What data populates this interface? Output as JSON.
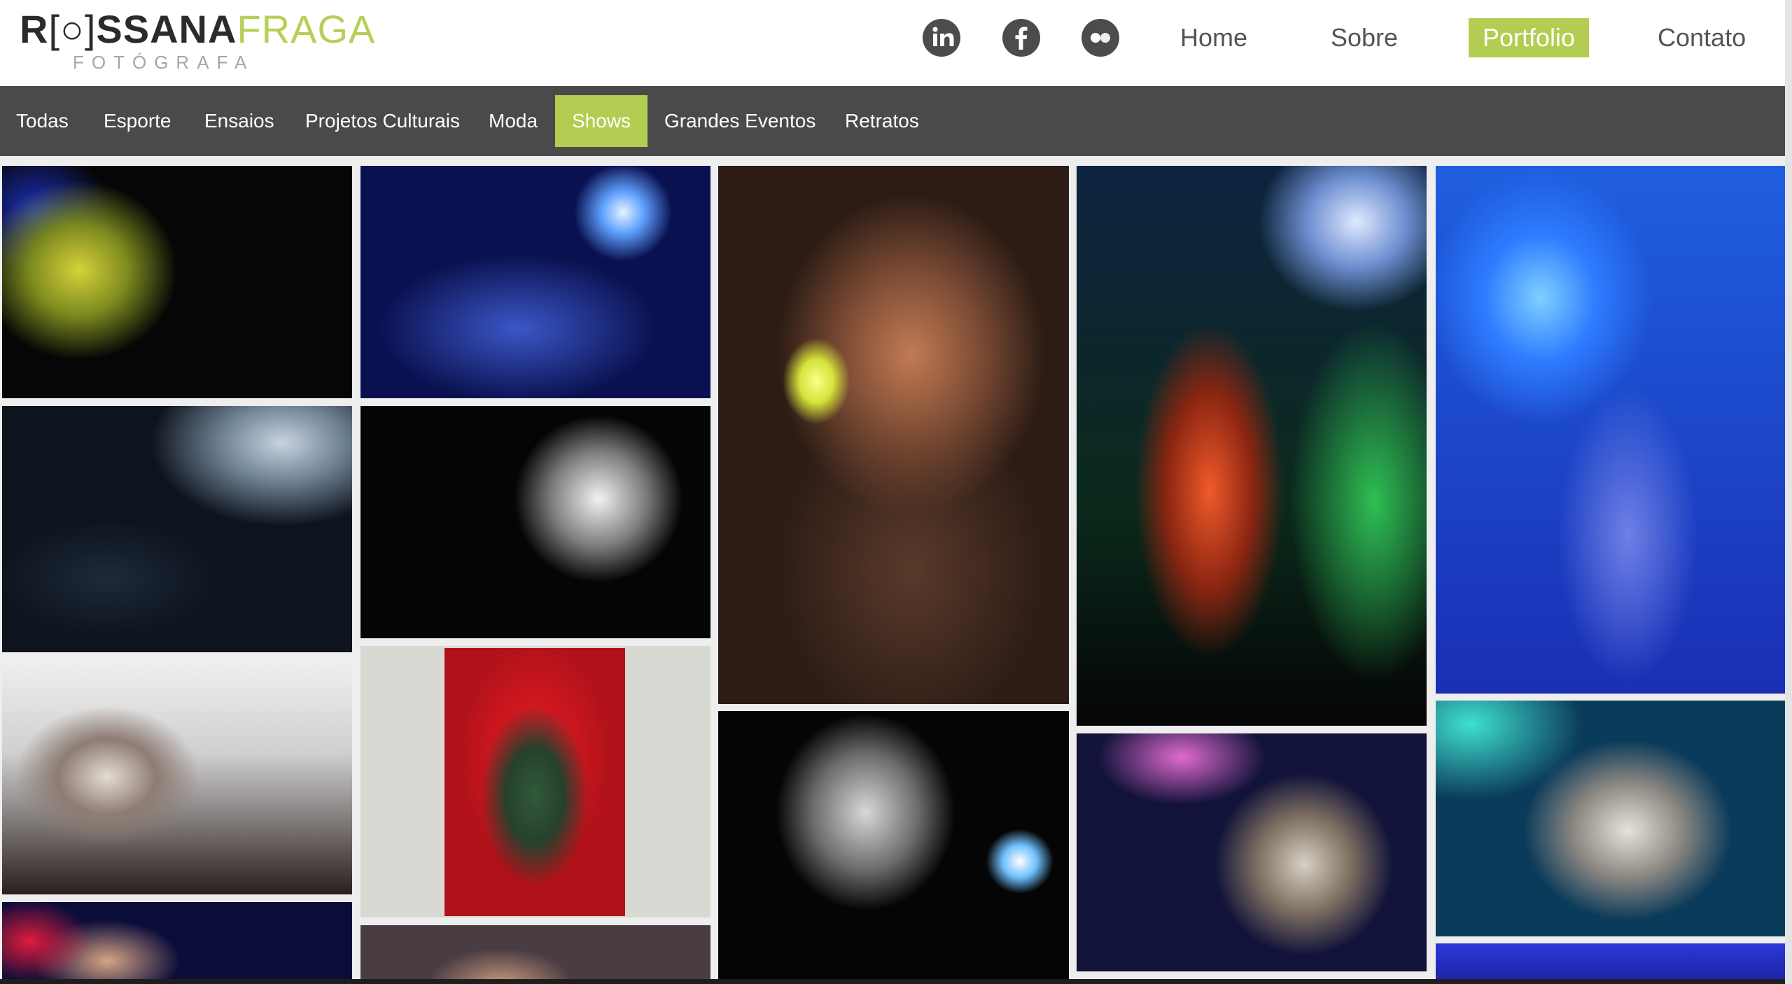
{
  "logo": {
    "part1": "R",
    "bracket": "[○]",
    "part2": "SSANA",
    "part3": "FRAGA",
    "subtitle": "FOTÓGRAFA"
  },
  "social": [
    {
      "name": "linkedin-icon",
      "glyph": "in"
    },
    {
      "name": "facebook-icon",
      "glyph": "f"
    },
    {
      "name": "flickr-icon",
      "glyph": "●●"
    }
  ],
  "nav": {
    "home": "Home",
    "sobre": "Sobre",
    "portfolio": "Portfolio",
    "contato": "Contato"
  },
  "filters": [
    {
      "label": "Todas"
    },
    {
      "label": "Esporte"
    },
    {
      "label": "Ensaios"
    },
    {
      "label": "Projetos Culturais"
    },
    {
      "label": "Moda"
    },
    {
      "label": "Shows",
      "active": true
    },
    {
      "label": "Grandes Eventos"
    },
    {
      "label": "Retratos"
    }
  ],
  "colors": {
    "accent": "#b3cd52",
    "filter_bar": "#4a4a4a",
    "nav_text": "#555555",
    "social_icon_bg": "#4c4c4c"
  }
}
